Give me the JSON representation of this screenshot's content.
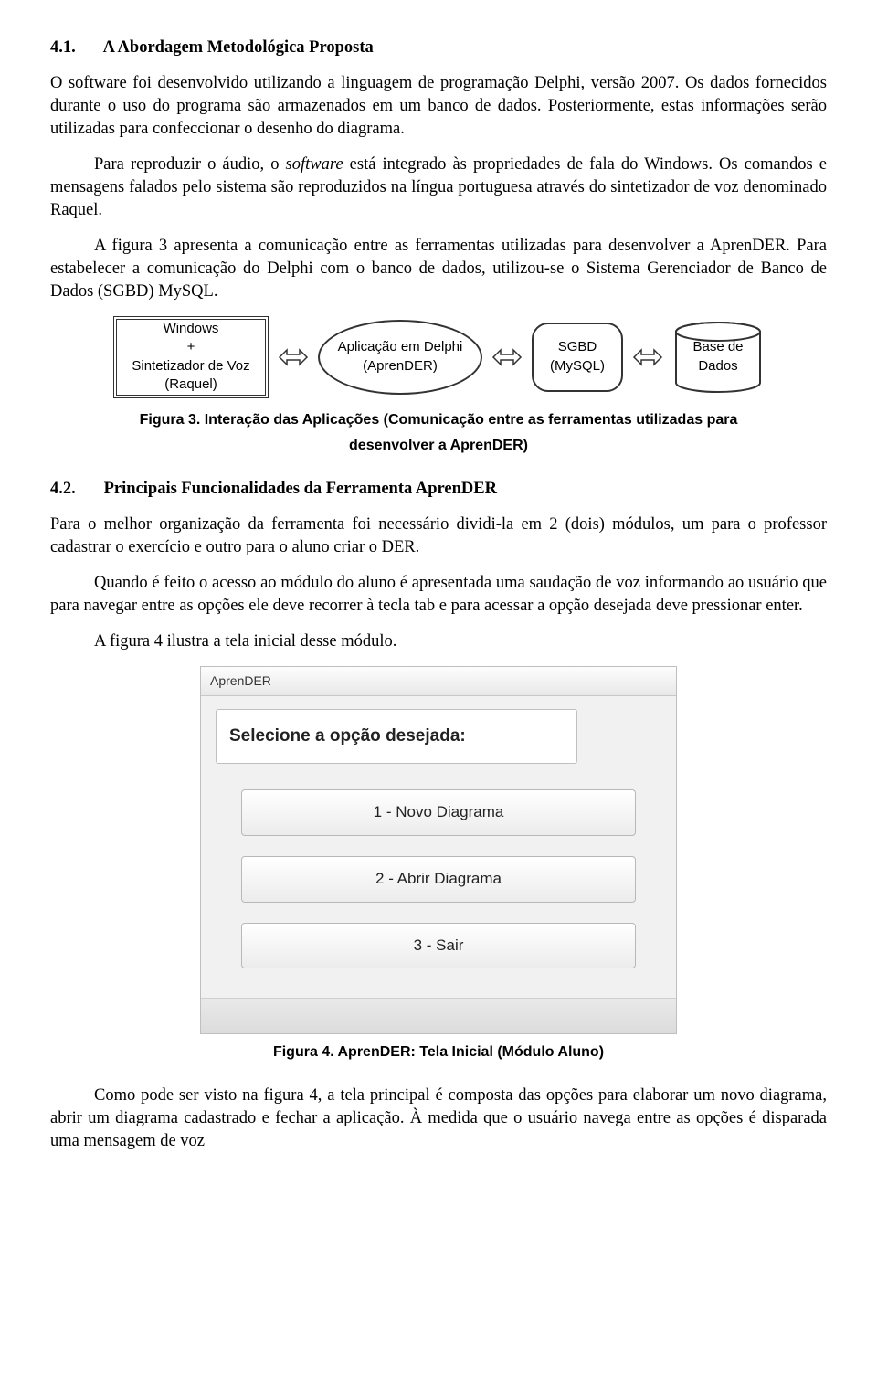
{
  "section1": {
    "num": "4.1.",
    "title": "A Abordagem Metodológica Proposta"
  },
  "para1": "O software foi desenvolvido utilizando a linguagem de programação Delphi, versão 2007. Os dados fornecidos durante o uso do programa são armazenados em um banco de dados. Posteriormente, estas informações serão utilizadas para confeccionar o desenho do diagrama.",
  "para2a": "Para reproduzir o áudio, o ",
  "para2b": "software",
  "para2c": " está integrado às propriedades de fala do Windows. Os comandos e mensagens falados pelo sistema são reproduzidos na língua portuguesa através do sintetizador de voz denominado Raquel.",
  "para3": "A figura 3 apresenta a comunicação entre as ferramentas utilizadas para desenvolver a AprenDER. Para estabelecer a comunicação do Delphi com o banco de dados, utilizou-se o Sistema Gerenciador de Banco de Dados (SGBD) MySQL.",
  "diagram": {
    "windows_line1": "Windows",
    "windows_line2": "+",
    "windows_line3": "Sintetizador de Voz",
    "windows_line4": "(Raquel)",
    "app_line1": "Aplicação em Delphi",
    "app_line2": "(AprenDER)",
    "sgbd_line1": "SGBD",
    "sgbd_line2": "(MySQL)",
    "db_line1": "Base de",
    "db_line2": "Dados"
  },
  "fig3_caption_line1": "Figura 3. Interação das Aplicações (Comunicação entre as ferramentas utilizadas para",
  "fig3_caption_line2": "desenvolver a AprenDER)",
  "section2": {
    "num": "4.2.",
    "title": "Principais Funcionalidades da Ferramenta AprenDER"
  },
  "para4": "Para o melhor organização da ferramenta foi necessário dividi-la em 2 (dois) módulos, um para o professor cadastrar o exercício e outro para o aluno criar o DER.",
  "para5": "Quando é feito o acesso ao módulo do aluno é apresentada uma saudação de voz informando ao usuário que para navegar entre as opções ele deve recorrer à tecla tab e para acessar a opção desejada deve pressionar enter.",
  "para6": "A figura 4 ilustra a tela inicial desse módulo.",
  "shot": {
    "title": "AprenDER",
    "prompt": "Selecione a opção desejada:",
    "option1": "1 - Novo Diagrama",
    "option2": "2 - Abrir Diagrama",
    "option3": "3 - Sair"
  },
  "fig4_caption": "Figura 4. AprenDER: Tela Inicial (Módulo Aluno)",
  "para7": "Como pode ser visto na figura 4, a tela principal é composta das opções para elaborar um novo diagrama, abrir um diagrama cadastrado e fechar a aplicação. À medida que o usuário navega entre as opções é disparada uma mensagem de voz"
}
